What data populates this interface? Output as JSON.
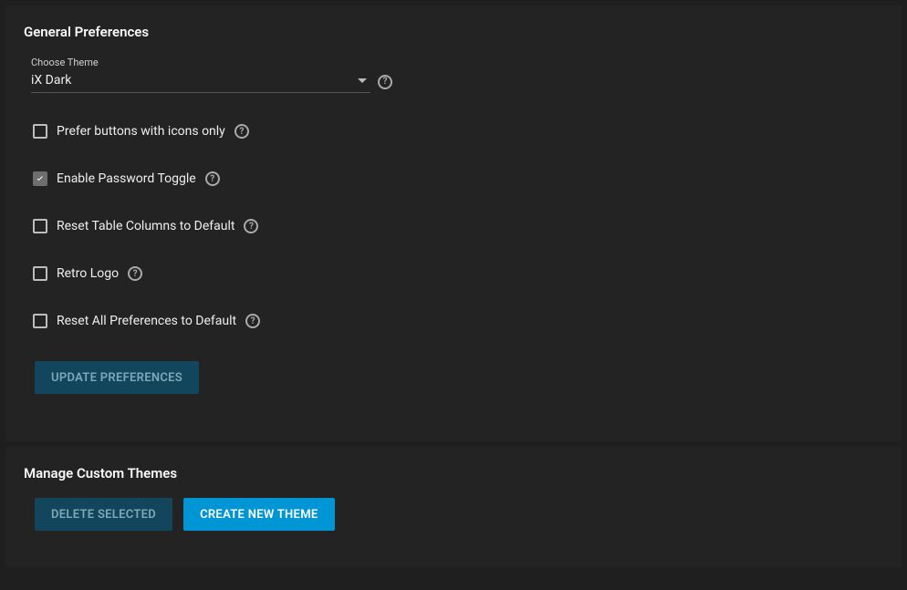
{
  "general": {
    "title": "General Preferences",
    "theme_label": "Choose Theme",
    "theme_value": "iX Dark",
    "checkboxes": {
      "icons_only": {
        "label": "Prefer buttons with icons only",
        "checked": false
      },
      "password_toggle": {
        "label": "Enable Password Toggle",
        "checked": true
      },
      "reset_columns": {
        "label": "Reset Table Columns to Default",
        "checked": false
      },
      "retro_logo": {
        "label": "Retro Logo",
        "checked": false
      },
      "reset_all": {
        "label": "Reset All Preferences to Default",
        "checked": false
      }
    },
    "update_label": "Update Preferences"
  },
  "themes": {
    "title": "Manage Custom Themes",
    "delete_label": "Delete Selected",
    "create_label": "Create New Theme"
  }
}
